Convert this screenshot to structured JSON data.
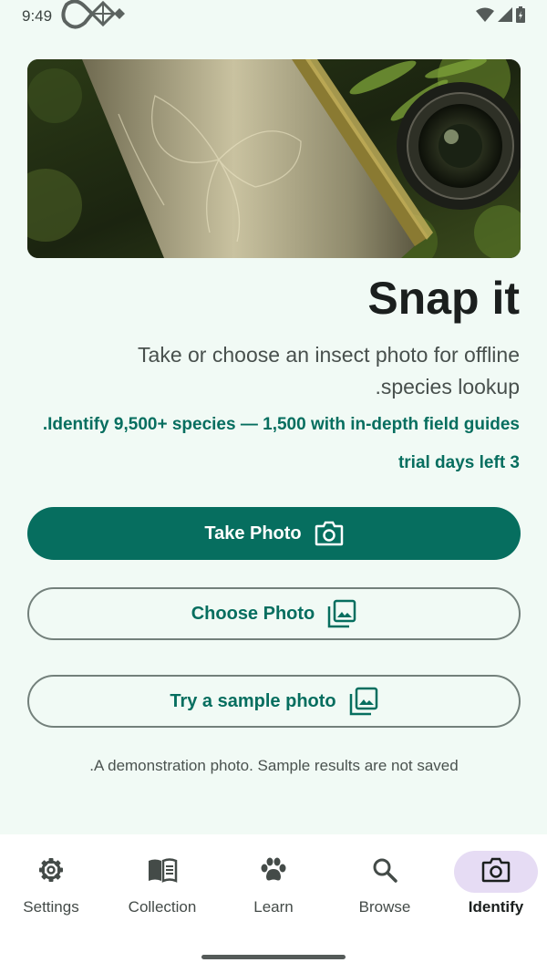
{
  "status_bar": {
    "time": "9:49"
  },
  "hero": {
    "image_icon": "notebook-and-camera-photo"
  },
  "main": {
    "title": "Snap it",
    "subtitle_line1": "Take or choose an insect photo for offline",
    "subtitle_line2": ".species lookup",
    "tagline": ".Identify 9,500+ species — 1,500 with in-depth field guides",
    "trial": "trial days left 3"
  },
  "buttons": {
    "take_photo": "Take Photo",
    "choose_photo": "Choose Photo",
    "sample_photo": "Try a sample photo"
  },
  "note": ".A demonstration photo. Sample results are not saved",
  "bottom_nav": {
    "items": [
      {
        "label": "Settings",
        "icon": "gear-icon"
      },
      {
        "label": "Collection",
        "icon": "book-icon"
      },
      {
        "label": "Learn",
        "icon": "paw-icon"
      },
      {
        "label": "Browse",
        "icon": "search-icon"
      },
      {
        "label": "Identify",
        "icon": "camera-icon",
        "active": true
      }
    ]
  },
  "colors": {
    "primary": "#066e5f",
    "background": "#f1faf5",
    "active_nav_pill": "#e6dcf4"
  }
}
